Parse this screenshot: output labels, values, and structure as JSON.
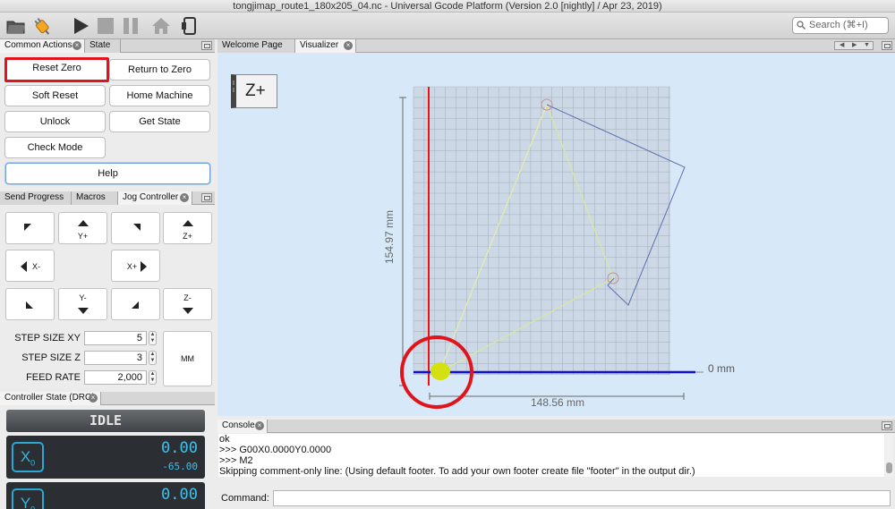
{
  "window": {
    "title": "tongjimap_route1_180x205_04.nc - Universal Gcode Platform (Version 2.0 [nightly]  / Apr 23, 2019)"
  },
  "toolbar": {
    "icons": [
      "open-folder-icon",
      "connect-icon",
      "play-icon",
      "stop-icon",
      "pause-icon",
      "home-icon",
      "probe-icon"
    ],
    "search_placeholder": "Search (⌘+I)"
  },
  "common_panel": {
    "tabs": [
      {
        "label": "Common Actions",
        "active": true
      },
      {
        "label": "State",
        "active": false
      }
    ],
    "buttons": {
      "reset_zero": "Reset Zero",
      "return_to_zero": "Return to Zero",
      "soft_reset": "Soft Reset",
      "home_machine": "Home Machine",
      "unlock": "Unlock",
      "get_state": "Get State",
      "check_mode": "Check Mode",
      "help": "Help"
    }
  },
  "jog_panel": {
    "tabs": [
      {
        "label": "Send Progress",
        "active": false
      },
      {
        "label": "Macros",
        "active": false
      },
      {
        "label": "Jog Controller",
        "active": true
      }
    ],
    "labels": {
      "y_plus": "Y+",
      "z_plus": "Z+",
      "x_minus": "X-",
      "x_plus": "X+",
      "y_minus": "Y-",
      "z_minus": "Z-",
      "mm": "MM"
    },
    "fields": {
      "step_xy_label": "STEP SIZE XY",
      "step_xy_value": "5",
      "step_z_label": "STEP SIZE Z",
      "step_z_value": "3",
      "feed_label": "FEED RATE",
      "feed_value": "2,000"
    }
  },
  "dro_panel": {
    "tab": "Controller State (DRO)",
    "state": "IDLE",
    "axes": [
      {
        "letter": "X",
        "sub": "0",
        "work": "0.00",
        "machine": "-65.00"
      },
      {
        "letter": "Y",
        "sub": "0",
        "work": "0.00",
        "machine": ""
      }
    ]
  },
  "editor_tabs": [
    {
      "label": "Welcome Page",
      "active": false
    },
    {
      "label": "Visualizer",
      "active": true
    }
  ],
  "visualizer": {
    "view_button": "Z+",
    "dim_y": "154.97 mm",
    "dim_x": "148.56 mm",
    "zero_label": "0 mm",
    "colors": {
      "background": "#d7e9f8",
      "grid": "#a9b4c0",
      "x_axis": "#1010d0",
      "y_axis": "#ee1111",
      "rapid": "#dbe89a",
      "feed": "#5d6fb0",
      "tool": "#d4e010",
      "annotation": "#e0141a"
    }
  },
  "console": {
    "tab": "Console",
    "lines": [
      "ok",
      ">>> G00X0.0000Y0.0000",
      ">>> M2",
      "Skipping comment-only line: (Using default footer. To add your own footer create file \"footer\" in the output dir.)"
    ],
    "command_label": "Command:"
  }
}
